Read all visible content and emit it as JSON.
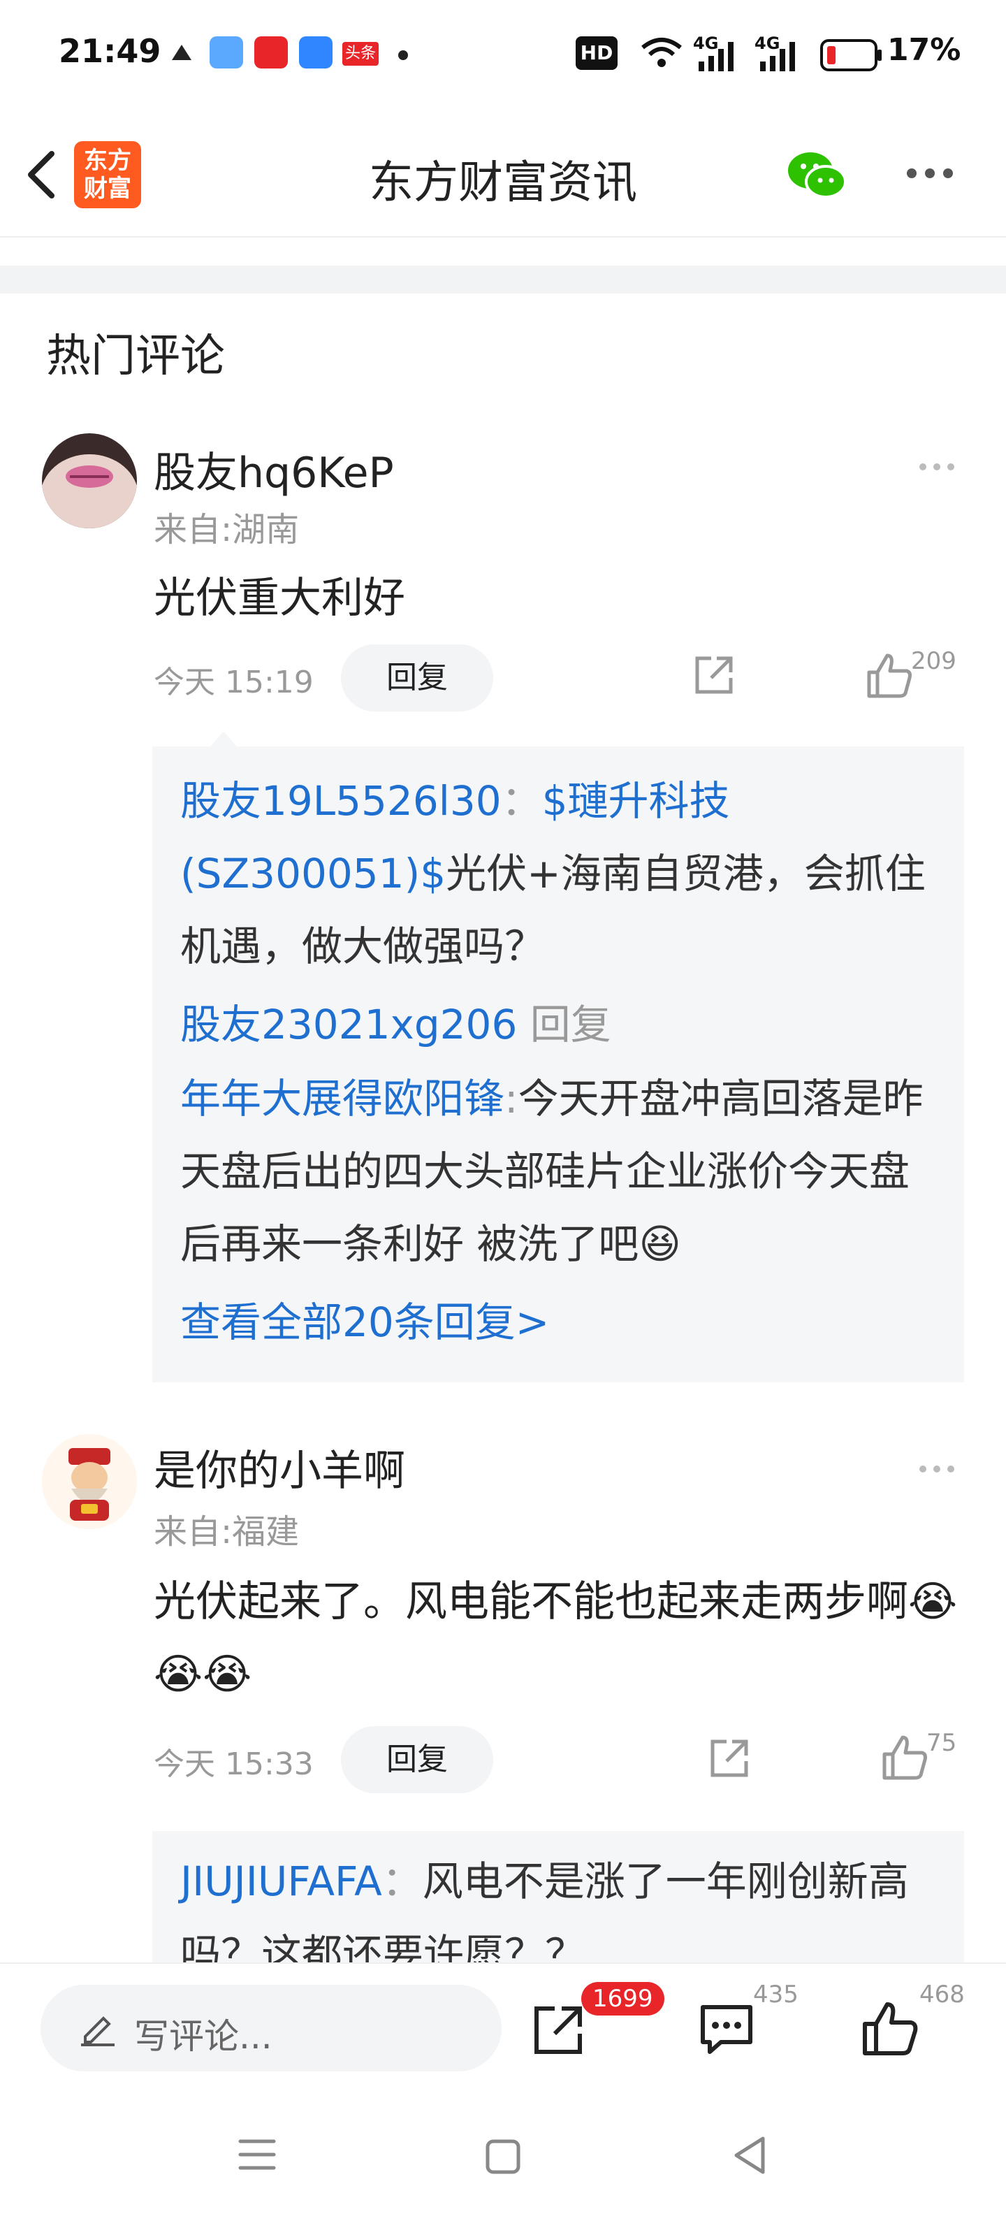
{
  "status_bar": {
    "time": "21:49",
    "hd": "HD",
    "network1": "4G",
    "network2": "4G",
    "battery": "17%",
    "toutiao_label": "头条"
  },
  "header": {
    "logo_text": "东方\n财富",
    "title": "东方财富资讯"
  },
  "section_title": "热门评论",
  "comments": [
    {
      "username": "股友hq6KeP",
      "region": "来自:湖南",
      "content": "光伏重大利好",
      "time": "今天 15:19",
      "reply_label": "回复",
      "likes": "209",
      "replies": [
        {
          "user": "股友19L5526l30",
          "sep": "：",
          "link": "$璉升科技(SZ300051)$",
          "text": "光伏+海南自贸港，会抓住机遇，做大做强吗？"
        },
        {
          "user": "股友23021xg206",
          "sep": " ",
          "action": "回复"
        },
        {
          "user": "年年大展得欧阳锋",
          "sep": ":",
          "text": "今天开盘冲高回落是昨天盘后出的四大头部硅片企业涨价今天盘后再来一条利好 被洗了吧😆"
        }
      ],
      "view_all": "查看全部20条回复>"
    },
    {
      "username": "是你的小羊啊",
      "region": "来自:福建",
      "content": "光伏起来了。风电能不能也起来走两步啊😭😭😭",
      "time": "今天 15:33",
      "reply_label": "回复",
      "likes": "75",
      "replies": [
        {
          "user": "JIUJIUFAFA",
          "sep": "：",
          "text": "风电不是涨了一年刚创新高吗？这都还要许愿？？"
        }
      ]
    }
  ],
  "bottom_bar": {
    "write_placeholder": "写评论...",
    "share_count": "1699",
    "comment_count": "435",
    "like_count": "468"
  }
}
